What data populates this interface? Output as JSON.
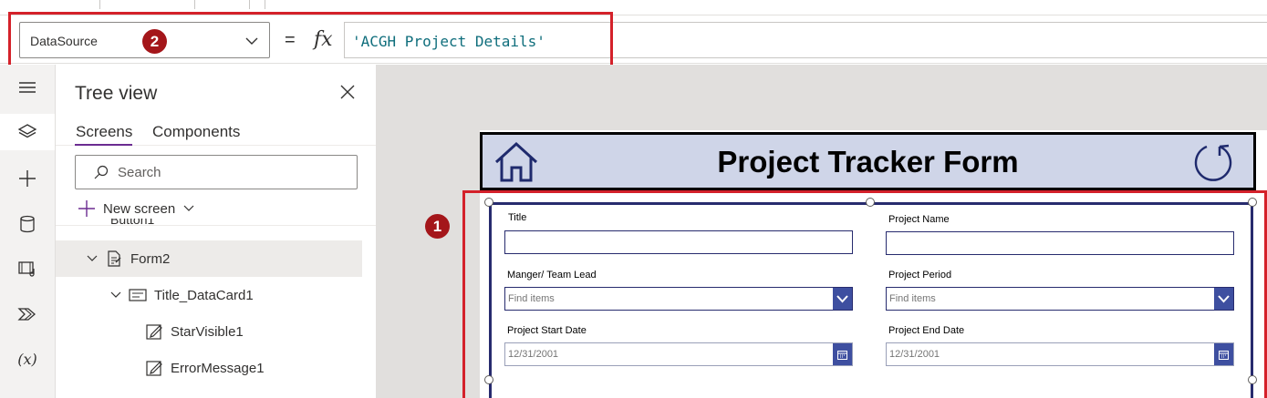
{
  "formula_bar": {
    "property": "DataSource",
    "equals": "=",
    "fx": "fx",
    "formula": "'ACGH Project Details'"
  },
  "annotations": {
    "badge1": "1",
    "badge2": "2",
    "accent_color": "#d4212a",
    "badge_color": "#a4161a"
  },
  "left_rail": {
    "items": [
      {
        "icon": "hamburger-menu-icon"
      },
      {
        "icon": "layers-icon",
        "active": true
      },
      {
        "icon": "plus-icon"
      },
      {
        "icon": "database-icon"
      },
      {
        "icon": "media-icon"
      },
      {
        "icon": "power-automate-icon"
      },
      {
        "icon": "variables-icon",
        "label": "(x)"
      }
    ]
  },
  "tree_view": {
    "title": "Tree view",
    "tabs": [
      "Screens",
      "Components"
    ],
    "search_placeholder": "Search",
    "new_screen": "New screen",
    "clipped_item": "Button1",
    "nodes": [
      {
        "label": "Form2",
        "icon": "form-icon",
        "expanded": true,
        "selected": true
      },
      {
        "label": "Title_DataCard1",
        "icon": "card-icon",
        "expanded": true
      },
      {
        "label": "StarVisible1",
        "icon": "edit-icon"
      },
      {
        "label": "ErrorMessage1",
        "icon": "edit-icon"
      }
    ]
  },
  "app": {
    "header_title": "Project Tracker Form",
    "header_color": "#cfd5e8",
    "form_border_color": "#272b6e",
    "fields": {
      "title": "Title",
      "project_name": "Project Name",
      "manager": "Manger/ Team Lead",
      "period": "Project Period",
      "start_date": "Project Start Date",
      "end_date": "Project End Date"
    },
    "combo_placeholder": "Find items",
    "date_placeholder": "12/31/2001"
  }
}
